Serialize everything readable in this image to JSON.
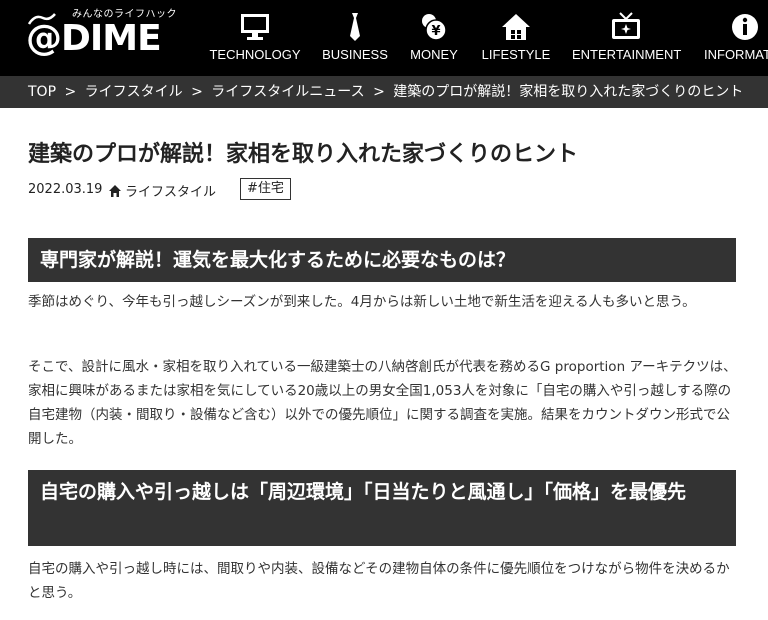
{
  "site": {
    "logo_text": "@DIME",
    "tagline": "みんなのライフハック"
  },
  "nav": [
    {
      "label": "TECHNOLOGY",
      "icon": "monitor-icon"
    },
    {
      "label": "BUSINESS",
      "icon": "necktie-icon"
    },
    {
      "label": "MONEY",
      "icon": "yen-coins-icon"
    },
    {
      "label": "LIFESTYLE",
      "icon": "house-icon"
    },
    {
      "label": "ENTERTAINMENT",
      "icon": "tv-icon"
    },
    {
      "label": "INFORMATI",
      "icon": "info-icon"
    }
  ],
  "breadcrumb": {
    "items": [
      "TOP",
      "ライフスタイル",
      "ライフスタイルニュース",
      "建築のプロが解説！家相を取り入れた家づくりのヒント"
    ],
    "separator": ">"
  },
  "article": {
    "title": "建築のプロが解説！家相を取り入れた家づくりのヒント",
    "date": "2022.03.19",
    "category": "ライフスタイル",
    "tag": "#住宅",
    "heading1": "専門家が解説！運気を最大化するために必要なものは？",
    "para1": "季節はめぐり、今年も引っ越しシーズンが到来した。4月からは新しい土地で新生活を迎える人も多いと思う。",
    "para2": "そこで、設計に風水・家相を取り入れている一級建築士の八納啓創氏が代表を務めるG proportion アーキテクツは、家相に興味があるまたは家相を気にしている20歳以上の男女全国1,053人を対象に「自宅の購入や引っ越しする際の自宅建物（内装・間取り・設備など含む）以外での優先順位」に関する調査を実施。結果をカウントダウン形式で公開した。",
    "heading2": "自宅の購入や引っ越しは「周辺環境」「日当たりと風通し」「価格」を最優先",
    "para3": "自宅の購入や引っ越し時には、間取りや内装、設備などその建物自体の条件に優先順位をつけながら物件を決めるかと思う。"
  },
  "colors": {
    "header_bg": "#000000",
    "breadcrumb_bg": "#333333",
    "heading_bg": "#333333"
  }
}
